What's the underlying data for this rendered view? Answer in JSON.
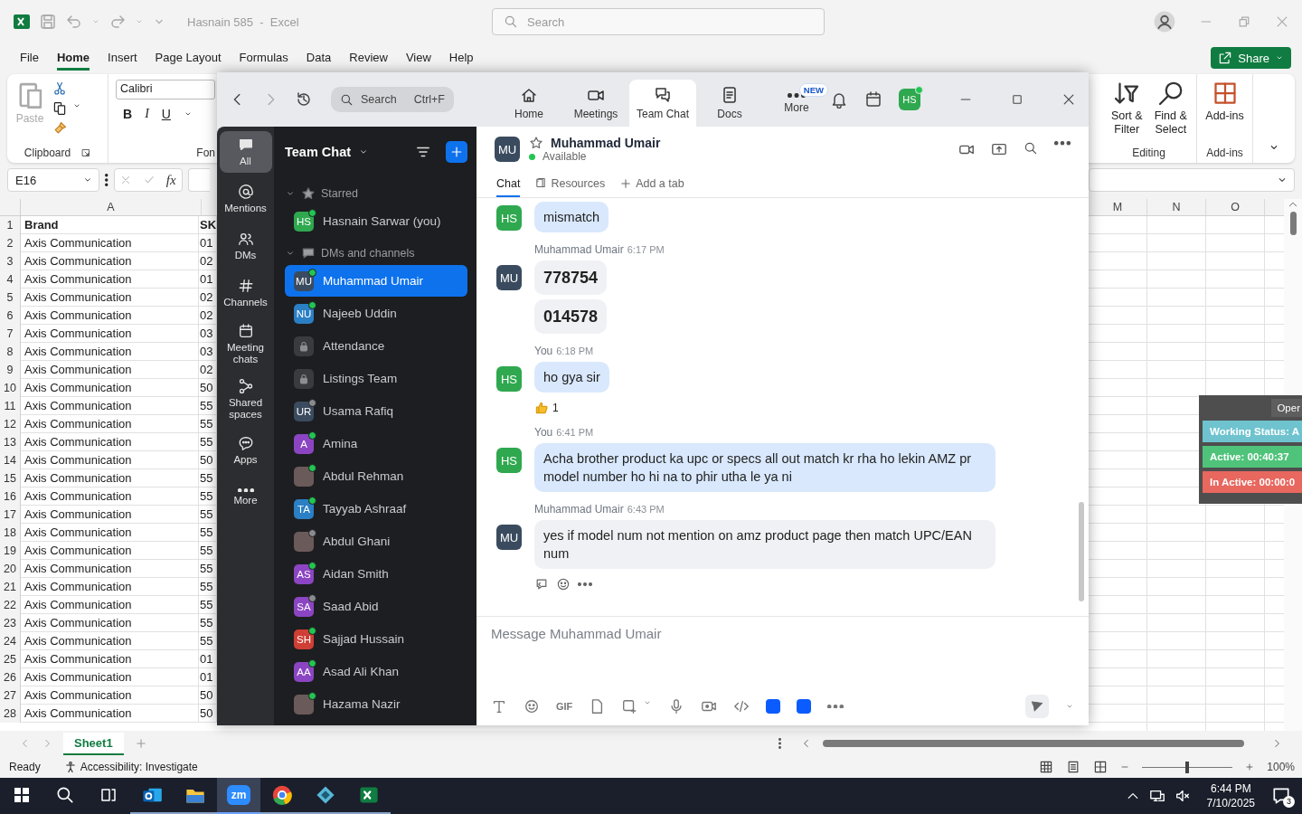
{
  "excel": {
    "title": "Hasnain 585  -  Excel",
    "search": {
      "placeholder": "Search"
    },
    "menu": [
      {
        "label": "File",
        "selected": false
      },
      {
        "label": "Home",
        "selected": true
      },
      {
        "label": "Insert",
        "selected": false
      },
      {
        "label": "Page Layout",
        "selected": false
      },
      {
        "label": "Formulas",
        "selected": false
      },
      {
        "label": "Data",
        "selected": false
      },
      {
        "label": "Review",
        "selected": false
      },
      {
        "label": "View",
        "selected": false
      },
      {
        "label": "Help",
        "selected": false
      }
    ],
    "share": "Share",
    "ribbon": {
      "paste": {
        "label": "Paste",
        "disabled": true
      },
      "clipboard_label": "Clipboard",
      "font_name": "Calibri",
      "bold": "B",
      "italic": "I",
      "underline": "U",
      "font_label": "Fon",
      "sort_filter": "Sort & Filter",
      "find_select": "Find & Select",
      "editing_label": "Editing",
      "addins": "Add-ins",
      "addins_label": "Add-ins"
    },
    "name_box": "E16",
    "fx": "fx",
    "columns_left": [
      "A"
    ],
    "columns_right": [
      "M",
      "N",
      "O"
    ],
    "header_row": {
      "num": "1",
      "a": "Brand",
      "b": "SK"
    },
    "rows": [
      {
        "num": "2",
        "a": "Axis Communication",
        "b": "01"
      },
      {
        "num": "3",
        "a": "Axis Communication",
        "b": "02"
      },
      {
        "num": "4",
        "a": "Axis Communication",
        "b": "01"
      },
      {
        "num": "5",
        "a": "Axis Communication",
        "b": "02"
      },
      {
        "num": "6",
        "a": "Axis Communication",
        "b": "02"
      },
      {
        "num": "7",
        "a": "Axis Communication",
        "b": "03"
      },
      {
        "num": "8",
        "a": "Axis Communication",
        "b": "03"
      },
      {
        "num": "9",
        "a": "Axis Communication",
        "b": "02"
      },
      {
        "num": "10",
        "a": "Axis Communication",
        "b": "50"
      },
      {
        "num": "11",
        "a": "Axis Communication",
        "b": "55"
      },
      {
        "num": "12",
        "a": "Axis Communication",
        "b": "55"
      },
      {
        "num": "13",
        "a": "Axis Communication",
        "b": "55"
      },
      {
        "num": "14",
        "a": "Axis Communication",
        "b": "50"
      },
      {
        "num": "15",
        "a": "Axis Communication",
        "b": "55"
      },
      {
        "num": "16",
        "a": "Axis Communication",
        "b": "55"
      },
      {
        "num": "17",
        "a": "Axis Communication",
        "b": "55"
      },
      {
        "num": "18",
        "a": "Axis Communication",
        "b": "55"
      },
      {
        "num": "19",
        "a": "Axis Communication",
        "b": "55"
      },
      {
        "num": "20",
        "a": "Axis Communication",
        "b": "55"
      },
      {
        "num": "21",
        "a": "Axis Communication",
        "b": "55"
      },
      {
        "num": "22",
        "a": "Axis Communication",
        "b": "55"
      },
      {
        "num": "23",
        "a": "Axis Communication",
        "b": "55"
      },
      {
        "num": "24",
        "a": "Axis Communication",
        "b": "55"
      },
      {
        "num": "25",
        "a": "Axis Communication",
        "b": "01"
      },
      {
        "num": "26",
        "a": "Axis Communication",
        "b": "01"
      },
      {
        "num": "27",
        "a": "Axis Communication",
        "b": "50"
      },
      {
        "num": "28",
        "a": "Axis Communication",
        "b": "50"
      }
    ],
    "sheets": [
      {
        "label": "Sheet1",
        "selected": true
      }
    ],
    "status": {
      "ready": "Ready",
      "accessibility": "Accessibility: Investigate",
      "zoom": {
        "level": 0.5,
        "reading": "100%"
      }
    }
  },
  "zoom_app": {
    "search": {
      "placeholder": "Search",
      "shortcut": "Ctrl+F"
    },
    "tabs": [
      {
        "label": "Home",
        "selected": false
      },
      {
        "label": "Meetings",
        "selected": false
      },
      {
        "label": "Team Chat",
        "selected": true
      },
      {
        "label": "Docs",
        "selected": false
      },
      {
        "label": "More",
        "selected": false,
        "badge": "NEW"
      }
    ],
    "me": {
      "initials": "HS",
      "online": true
    },
    "rail": [
      {
        "label": "All",
        "selected": true
      },
      {
        "label": "Mentions",
        "selected": false
      },
      {
        "label": "DMs",
        "selected": false
      },
      {
        "label": "Channels",
        "selected": false
      },
      {
        "label": "Meeting chats",
        "selected": false
      },
      {
        "label": "Shared spaces",
        "selected": false
      },
      {
        "label": "Apps",
        "selected": false
      },
      {
        "label": "More",
        "selected": false
      }
    ],
    "sidebar": {
      "title": "Team Chat",
      "sections": [
        {
          "title": "Starred",
          "expanded": true,
          "items": [
            {
              "kind": "person",
              "initials": "HS",
              "label": "Hasnain Sarwar (you)",
              "color": "#2fa84f",
              "online": true,
              "selected": false
            }
          ]
        },
        {
          "title": "DMs and channels",
          "expanded": true,
          "items": [
            {
              "kind": "person",
              "initials": "MU",
              "label": "Muhammad Umair",
              "color": "#3b4b5f",
              "online": true,
              "selected": true
            },
            {
              "kind": "person",
              "initials": "NU",
              "label": "Najeeb Uddin",
              "color": "#2b7fc4",
              "online": true,
              "selected": false
            },
            {
              "kind": "channel",
              "label": "Attendance",
              "selected": false
            },
            {
              "kind": "channel",
              "label": "Listings Team",
              "selected": false
            },
            {
              "kind": "person",
              "initials": "UR",
              "label": "Usama Rafiq",
              "color": "#3b4b5f",
              "online": false,
              "selected": false
            },
            {
              "kind": "person",
              "initials": "A",
              "label": "Amina",
              "color": "#8b45c2",
              "online": true,
              "selected": false
            },
            {
              "kind": "photo",
              "label": "Abdul Rehman",
              "online": true,
              "selected": false
            },
            {
              "kind": "person",
              "initials": "TA",
              "label": "Tayyab Ashraaf",
              "color": "#2b7fc4",
              "online": true,
              "selected": false
            },
            {
              "kind": "photo",
              "label": "Abdul Ghani",
              "online": false,
              "selected": false
            },
            {
              "kind": "person",
              "initials": "AS",
              "label": "Aidan Smith",
              "color": "#8b45c2",
              "online": true,
              "selected": false
            },
            {
              "kind": "person",
              "initials": "SA",
              "label": "Saad Abid",
              "color": "#8b45c2",
              "online": false,
              "selected": false
            },
            {
              "kind": "person",
              "initials": "SH",
              "label": "Sajjad Hussain",
              "color": "#cf3f35",
              "online": true,
              "selected": false
            },
            {
              "kind": "person",
              "initials": "AA",
              "label": "Asad Ali Khan",
              "color": "#8b45c2",
              "online": true,
              "selected": false
            },
            {
              "kind": "photo",
              "label": "Hazama Nazir",
              "online": true,
              "selected": false
            }
          ]
        }
      ]
    },
    "chat": {
      "contact": {
        "initials": "MU",
        "name": "Muhammad Umair",
        "status": "Available",
        "starred": false
      },
      "tabs": [
        {
          "label": "Chat",
          "selected": true
        },
        {
          "label": "Resources",
          "selected": false
        },
        {
          "label": "Add a tab",
          "selected": false
        }
      ],
      "messages": [
        {
          "avatar": "HS",
          "color": "#2fa84f",
          "mine": true,
          "bubbles": [
            {
              "text": "mismatch",
              "big": false
            }
          ]
        },
        {
          "avatar": "MU",
          "color": "#3b4b5f",
          "sender": "Muhammad Umair",
          "time": "6:17 PM",
          "mine": false,
          "bubbles": [
            {
              "text": "778754",
              "big": true
            },
            {
              "text": "014578",
              "big": true
            }
          ]
        },
        {
          "avatar": "HS",
          "color": "#2fa84f",
          "sender": "You",
          "time": "6:18 PM",
          "mine": true,
          "bubbles": [
            {
              "text": "ho gya sir",
              "big": false
            }
          ],
          "reaction_count": "1"
        },
        {
          "avatar": "HS",
          "color": "#2fa84f",
          "sender": "You",
          "time": "6:41 PM",
          "mine": true,
          "bubbles": [
            {
              "text": "Acha brother product ka upc or specs all out match kr rha ho lekin AMZ pr model number ho hi na to phir utha le ya ni",
              "big": false
            }
          ]
        },
        {
          "avatar": "MU",
          "color": "#3b4b5f",
          "sender": "Muhammad Umair",
          "time": "6:43 PM",
          "mine": false,
          "bubbles": [
            {
              "text": "yes if model num not mention on amz product page then match UPC/EAN num",
              "big": false
            }
          ],
          "show_actions": true
        }
      ],
      "composer": {
        "placeholder": "Message Muhammad Umair",
        "gif": "GIF"
      }
    }
  },
  "tracker": {
    "button": "Oper",
    "statuses": [
      {
        "label": "Working Status: A",
        "color": "#6ec3cf"
      },
      {
        "label": "Active: 00:40:37",
        "color": "#4fc37a"
      },
      {
        "label": "In Active: 00:00:0",
        "color": "#e8675e"
      }
    ]
  },
  "taskbar": {
    "items": [
      {
        "kind": "start",
        "running": false,
        "selected": false
      },
      {
        "kind": "search",
        "running": false,
        "selected": false
      },
      {
        "kind": "task_view",
        "running": false,
        "selected": false
      },
      {
        "kind": "outlook",
        "running": true,
        "selected": false
      },
      {
        "kind": "files",
        "running": true,
        "selected": false
      },
      {
        "kind": "zoom",
        "label": "zm",
        "running": true,
        "selected": true
      },
      {
        "kind": "chrome",
        "running": true,
        "selected": false
      },
      {
        "kind": "app",
        "running": true,
        "selected": false
      },
      {
        "kind": "excel",
        "running": true,
        "selected": false
      }
    ],
    "time": "6:44 PM",
    "date": "7/10/2025",
    "notifications": "3"
  }
}
